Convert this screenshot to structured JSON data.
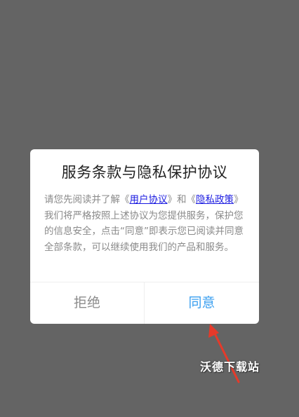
{
  "dialog": {
    "title": "服务条款与隐私保护协议",
    "body_intro": "请您先阅读并了解《",
    "user_agreement_link": "用户协议",
    "body_and": "》和《",
    "privacy_link": "隐私政策",
    "body_rest": "》我们将严格按照上述协议为您提供服务，保护您的信息安全，点击“同意”即表示您已阅读并同意全部条款，可以继续使用我们的产品和服务。",
    "reject_label": "拒绝",
    "agree_label": "同意"
  },
  "watermark": {
    "text": "沃德下载站"
  },
  "colors": {
    "overlay": "#646464",
    "agree_button": "#3a9ff0",
    "reject_button": "#8c8c8c",
    "link": "#1a1ae0",
    "arrow": "#e53a2a"
  }
}
